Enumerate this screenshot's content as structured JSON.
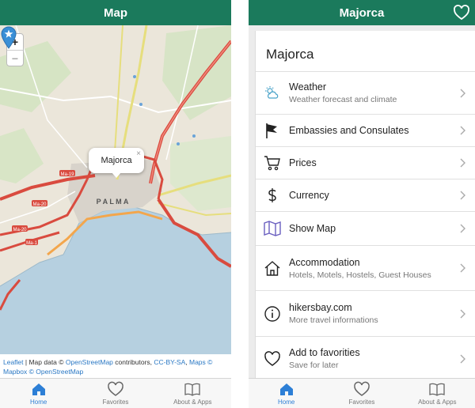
{
  "left_screen": {
    "title": "Map",
    "zoom_in": "+",
    "zoom_out": "−",
    "popup": {
      "label": "Majorca",
      "close": "×"
    },
    "map_labels": {
      "city": "P A L M A",
      "road_1": "Ma-20",
      "road_2": "Ma-20",
      "road_3": "Ma-1",
      "road_4": "Ma-19"
    },
    "attribution": {
      "leaflet": "Leaflet",
      "text1": " | Map data © ",
      "osm1": "OpenStreetMap",
      "text2": " contributors, ",
      "license": "CC-BY-SA",
      "text3": ", ",
      "maps": "Maps ©",
      "text4": " ",
      "mapbox": "Mapbox © OpenStreetMap"
    },
    "tabs": [
      {
        "label": "Home",
        "icon": "house-icon",
        "active": true
      },
      {
        "label": "Favorites",
        "icon": "heart-icon",
        "active": false
      },
      {
        "label": "About & Apps",
        "icon": "book-icon",
        "active": false
      }
    ]
  },
  "right_screen": {
    "title": "Majorca",
    "card_title": "Majorca",
    "rows": [
      {
        "title": "Weather",
        "subtitle": "Weather forecast and climate",
        "icon": "weather-icon"
      },
      {
        "title": "Embassies and Consulates",
        "subtitle": "",
        "icon": "flag-icon"
      },
      {
        "title": "Prices",
        "subtitle": "",
        "icon": "cart-icon"
      },
      {
        "title": "Currency",
        "subtitle": "",
        "icon": "dollar-icon"
      },
      {
        "title": "Show Map",
        "subtitle": "",
        "icon": "map-icon"
      },
      {
        "title": "Accommodation",
        "subtitle": "Hotels, Motels, Hostels, Guest Houses",
        "icon": "house-icon"
      },
      {
        "title": "hikersbay.com",
        "subtitle": "More travel informations",
        "icon": "info-icon"
      },
      {
        "title": "Add to favorities",
        "subtitle": "Save for later",
        "icon": "heart-icon"
      }
    ],
    "tabs": [
      {
        "label": "Home",
        "icon": "house-icon",
        "active": true
      },
      {
        "label": "Favorites",
        "icon": "heart-icon",
        "active": false
      },
      {
        "label": "About & Apps",
        "icon": "book-icon",
        "active": false
      }
    ]
  },
  "colors": {
    "header": "#1b7a5c",
    "active_tab": "#2d7fd6",
    "link": "#2a78c4",
    "pin": "#3a8fd6"
  }
}
